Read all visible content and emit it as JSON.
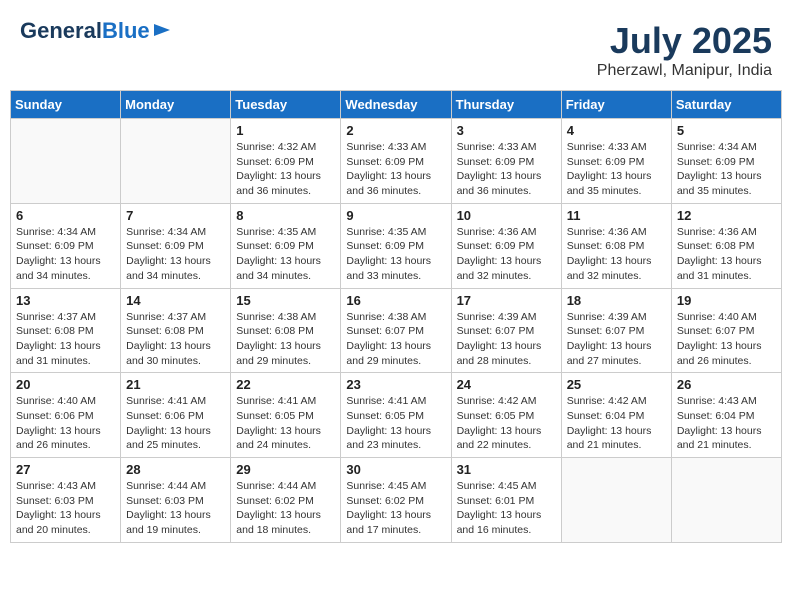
{
  "header": {
    "logo_general": "General",
    "logo_blue": "Blue",
    "month_year": "July 2025",
    "location": "Pherzawl, Manipur, India"
  },
  "weekdays": [
    "Sunday",
    "Monday",
    "Tuesday",
    "Wednesday",
    "Thursday",
    "Friday",
    "Saturday"
  ],
  "weeks": [
    [
      {
        "day": "",
        "info": ""
      },
      {
        "day": "",
        "info": ""
      },
      {
        "day": "1",
        "info": "Sunrise: 4:32 AM\nSunset: 6:09 PM\nDaylight: 13 hours and 36 minutes."
      },
      {
        "day": "2",
        "info": "Sunrise: 4:33 AM\nSunset: 6:09 PM\nDaylight: 13 hours and 36 minutes."
      },
      {
        "day": "3",
        "info": "Sunrise: 4:33 AM\nSunset: 6:09 PM\nDaylight: 13 hours and 36 minutes."
      },
      {
        "day": "4",
        "info": "Sunrise: 4:33 AM\nSunset: 6:09 PM\nDaylight: 13 hours and 35 minutes."
      },
      {
        "day": "5",
        "info": "Sunrise: 4:34 AM\nSunset: 6:09 PM\nDaylight: 13 hours and 35 minutes."
      }
    ],
    [
      {
        "day": "6",
        "info": "Sunrise: 4:34 AM\nSunset: 6:09 PM\nDaylight: 13 hours and 34 minutes."
      },
      {
        "day": "7",
        "info": "Sunrise: 4:34 AM\nSunset: 6:09 PM\nDaylight: 13 hours and 34 minutes."
      },
      {
        "day": "8",
        "info": "Sunrise: 4:35 AM\nSunset: 6:09 PM\nDaylight: 13 hours and 34 minutes."
      },
      {
        "day": "9",
        "info": "Sunrise: 4:35 AM\nSunset: 6:09 PM\nDaylight: 13 hours and 33 minutes."
      },
      {
        "day": "10",
        "info": "Sunrise: 4:36 AM\nSunset: 6:09 PM\nDaylight: 13 hours and 32 minutes."
      },
      {
        "day": "11",
        "info": "Sunrise: 4:36 AM\nSunset: 6:08 PM\nDaylight: 13 hours and 32 minutes."
      },
      {
        "day": "12",
        "info": "Sunrise: 4:36 AM\nSunset: 6:08 PM\nDaylight: 13 hours and 31 minutes."
      }
    ],
    [
      {
        "day": "13",
        "info": "Sunrise: 4:37 AM\nSunset: 6:08 PM\nDaylight: 13 hours and 31 minutes."
      },
      {
        "day": "14",
        "info": "Sunrise: 4:37 AM\nSunset: 6:08 PM\nDaylight: 13 hours and 30 minutes."
      },
      {
        "day": "15",
        "info": "Sunrise: 4:38 AM\nSunset: 6:08 PM\nDaylight: 13 hours and 29 minutes."
      },
      {
        "day": "16",
        "info": "Sunrise: 4:38 AM\nSunset: 6:07 PM\nDaylight: 13 hours and 29 minutes."
      },
      {
        "day": "17",
        "info": "Sunrise: 4:39 AM\nSunset: 6:07 PM\nDaylight: 13 hours and 28 minutes."
      },
      {
        "day": "18",
        "info": "Sunrise: 4:39 AM\nSunset: 6:07 PM\nDaylight: 13 hours and 27 minutes."
      },
      {
        "day": "19",
        "info": "Sunrise: 4:40 AM\nSunset: 6:07 PM\nDaylight: 13 hours and 26 minutes."
      }
    ],
    [
      {
        "day": "20",
        "info": "Sunrise: 4:40 AM\nSunset: 6:06 PM\nDaylight: 13 hours and 26 minutes."
      },
      {
        "day": "21",
        "info": "Sunrise: 4:41 AM\nSunset: 6:06 PM\nDaylight: 13 hours and 25 minutes."
      },
      {
        "day": "22",
        "info": "Sunrise: 4:41 AM\nSunset: 6:05 PM\nDaylight: 13 hours and 24 minutes."
      },
      {
        "day": "23",
        "info": "Sunrise: 4:41 AM\nSunset: 6:05 PM\nDaylight: 13 hours and 23 minutes."
      },
      {
        "day": "24",
        "info": "Sunrise: 4:42 AM\nSunset: 6:05 PM\nDaylight: 13 hours and 22 minutes."
      },
      {
        "day": "25",
        "info": "Sunrise: 4:42 AM\nSunset: 6:04 PM\nDaylight: 13 hours and 21 minutes."
      },
      {
        "day": "26",
        "info": "Sunrise: 4:43 AM\nSunset: 6:04 PM\nDaylight: 13 hours and 21 minutes."
      }
    ],
    [
      {
        "day": "27",
        "info": "Sunrise: 4:43 AM\nSunset: 6:03 PM\nDaylight: 13 hours and 20 minutes."
      },
      {
        "day": "28",
        "info": "Sunrise: 4:44 AM\nSunset: 6:03 PM\nDaylight: 13 hours and 19 minutes."
      },
      {
        "day": "29",
        "info": "Sunrise: 4:44 AM\nSunset: 6:02 PM\nDaylight: 13 hours and 18 minutes."
      },
      {
        "day": "30",
        "info": "Sunrise: 4:45 AM\nSunset: 6:02 PM\nDaylight: 13 hours and 17 minutes."
      },
      {
        "day": "31",
        "info": "Sunrise: 4:45 AM\nSunset: 6:01 PM\nDaylight: 13 hours and 16 minutes."
      },
      {
        "day": "",
        "info": ""
      },
      {
        "day": "",
        "info": ""
      }
    ]
  ]
}
